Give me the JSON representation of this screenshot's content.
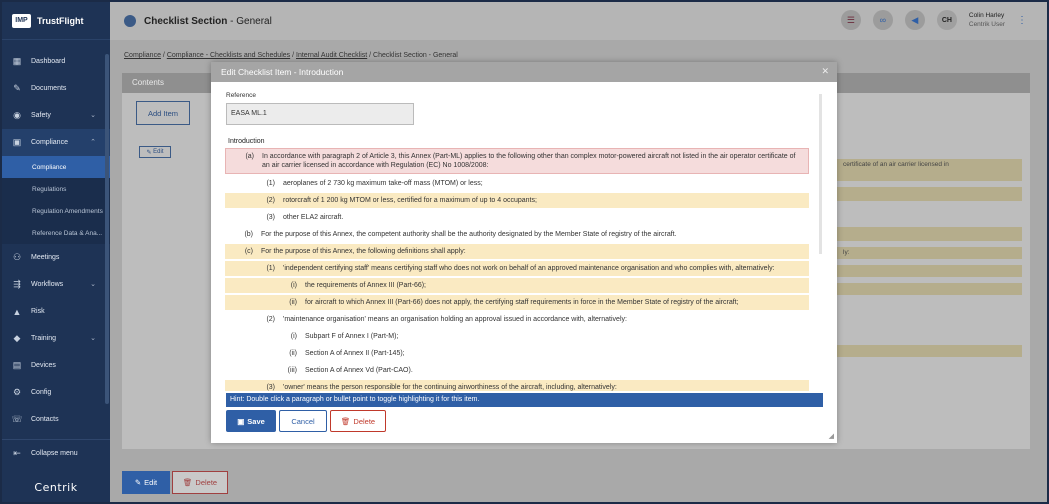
{
  "app": {
    "logo_text": "IMP",
    "name": "TrustFlight",
    "footer_logo": "Centrik"
  },
  "sidebar": {
    "items": [
      {
        "label": "Dashboard"
      },
      {
        "label": "Documents"
      },
      {
        "label": "Safety"
      },
      {
        "label": "Compliance"
      }
    ],
    "compliance_sub": [
      {
        "label": "Compliance"
      },
      {
        "label": "Regulations"
      },
      {
        "label": "Regulation Amendments"
      },
      {
        "label": "Reference Data & Ana..."
      }
    ],
    "items_after": [
      {
        "label": "Meetings"
      },
      {
        "label": "Workflows"
      },
      {
        "label": "Risk"
      },
      {
        "label": "Training"
      },
      {
        "label": "Devices"
      },
      {
        "label": "Config"
      },
      {
        "label": "Contacts"
      }
    ],
    "collapse_label": "Collapse menu"
  },
  "header": {
    "title": "Checklist Section",
    "title_suffix": " - General",
    "user_initials": "CH",
    "user_name": "Colin Harley",
    "user_role": "Centrik User"
  },
  "breadcrumb": {
    "items": [
      "Compliance",
      "Compliance - Checklists and Schedules",
      "Internal Audit Checklist"
    ],
    "current": "Checklist Section - General",
    "separator": " / "
  },
  "panel": {
    "title": "Contents",
    "add_item_label": "Add Item",
    "edit_label": "Edit",
    "bg_rows": [
      "certificate of an air carrier licensed in",
      "",
      "",
      "",
      "ly:",
      "",
      ""
    ]
  },
  "bottom": {
    "edit_label": "Edit",
    "delete_label": "Delete"
  },
  "modal": {
    "title": "Edit Checklist Item - Introduction",
    "reference_label": "Reference",
    "reference_value": "EASA ML.1",
    "intro_label": "Introduction",
    "items": [
      {
        "label": "(a)",
        "text": "In accordance with paragraph 2 of Article 3, this Annex (Part-ML) applies to the following other than complex motor-powered aircraft not listed in the air operator certificate of an air carrier licensed in accordance with Regulation (EC) No 1008/2008:",
        "style": "red",
        "indent": 0
      },
      {
        "label": "(1)",
        "text": "aeroplanes of 2 730 kg maximum take-off mass (MTOM) or less;",
        "style": "none",
        "indent": 1
      },
      {
        "label": "(2)",
        "text": "rotorcraft of 1 200 kg MTOM or less, certified for a maximum of up to 4 occupants;",
        "style": "yel",
        "indent": 1
      },
      {
        "label": "(3)",
        "text": "other ELA2 aircraft.",
        "style": "none",
        "indent": 1
      },
      {
        "label": "(b)",
        "text": "For the purpose of this Annex, the competent authority shall be the authority designated by the Member State of registry of the aircraft.",
        "style": "none",
        "indent": 0
      },
      {
        "label": "(c)",
        "text": "For the purpose of this Annex, the following definitions shall apply:",
        "style": "yel",
        "indent": 0
      },
      {
        "label": "(1)",
        "text": "'independent certifying staff' means certifying staff who does not work on behalf of an approved maintenance organisation and who complies with, alternatively:",
        "style": "yel",
        "indent": 1
      },
      {
        "label": "(i)",
        "text": "the requirements of Annex III (Part-66);",
        "style": "yel",
        "indent": 2
      },
      {
        "label": "(ii)",
        "text": "for aircraft to which Annex III (Part-66) does not apply, the certifying staff requirements in force in the Member State of registry of the aircraft;",
        "style": "yel",
        "indent": 2
      },
      {
        "label": "(2)",
        "text": "'maintenance organisation' means an organisation holding an approval issued in accordance with, alternatively:",
        "style": "none",
        "indent": 1
      },
      {
        "label": "(i)",
        "text": "Subpart F of Annex I (Part-M);",
        "style": "none",
        "indent": 2
      },
      {
        "label": "(ii)",
        "text": "Section A of Annex II (Part-145);",
        "style": "none",
        "indent": 2
      },
      {
        "label": "(iii)",
        "text": "Section A of Annex Vd (Part-CAO).",
        "style": "none",
        "indent": 2
      },
      {
        "label": "(3)",
        "text": "'owner' means the person responsible for the continuing airworthiness of the aircraft, including, alternatively:",
        "style": "yel",
        "indent": 1
      }
    ],
    "hint": "Hint: Double click a paragraph or bullet point to toggle highlighting it for this item.",
    "save_label": "Save",
    "cancel_label": "Cancel",
    "delete_label": "Delete"
  }
}
